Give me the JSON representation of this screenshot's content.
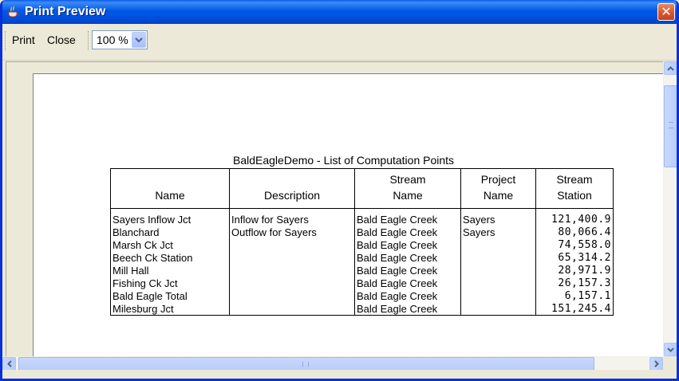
{
  "window": {
    "title": "Print Preview",
    "title_icon": "java-coffee-cup-icon",
    "close_icon": "close-icon"
  },
  "toolbar": {
    "print_label": "Print",
    "close_label": "Close",
    "zoom_value": "100 %"
  },
  "report": {
    "title": "BaldEagleDemo - List of Computation Points",
    "columns": [
      {
        "line1": "",
        "line2": "Name"
      },
      {
        "line1": "",
        "line2": "Description"
      },
      {
        "line1": "Stream",
        "line2": "Name"
      },
      {
        "line1": "Project",
        "line2": "Name"
      },
      {
        "line1": "Stream",
        "line2": "Station"
      }
    ],
    "rows": [
      {
        "name": "Sayers Inflow Jct",
        "description": "Inflow for Sayers",
        "stream": "Bald Eagle Creek",
        "project": "Sayers",
        "station": "121,400.9"
      },
      {
        "name": "Blanchard",
        "description": "Outflow for Sayers",
        "stream": "Bald Eagle Creek",
        "project": "Sayers",
        "station": "80,066.4"
      },
      {
        "name": "Marsh Ck Jct",
        "description": "",
        "stream": "Bald Eagle Creek",
        "project": "",
        "station": "74,558.0"
      },
      {
        "name": "Beech Ck Station",
        "description": "",
        "stream": "Bald Eagle Creek",
        "project": "",
        "station": "65,314.2"
      },
      {
        "name": "Mill Hall",
        "description": "",
        "stream": "Bald Eagle Creek",
        "project": "",
        "station": "28,971.9"
      },
      {
        "name": "Fishing Ck Jct",
        "description": "",
        "stream": "Bald Eagle Creek",
        "project": "",
        "station": "26,157.3"
      },
      {
        "name": "Bald Eagle Total",
        "description": "",
        "stream": "Bald Eagle Creek",
        "project": "",
        "station": "6,157.1"
      },
      {
        "name": "Milesburg Jct",
        "description": "",
        "stream": "Bald Eagle Creek",
        "project": "",
        "station": "151,245.4"
      }
    ]
  },
  "colors": {
    "titlebar": "#0054e3",
    "close_button": "#d65329",
    "scrollbar": "#c3d3fd"
  }
}
